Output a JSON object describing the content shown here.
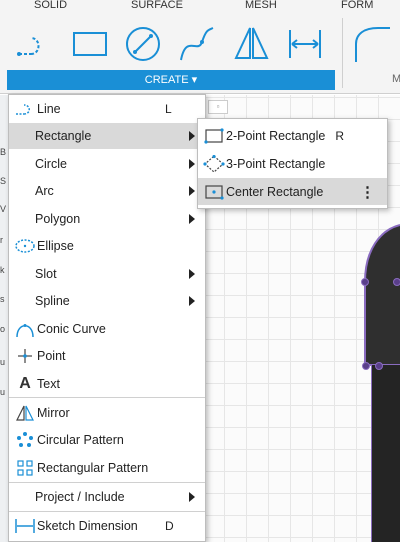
{
  "toolbar": {
    "tabs": [
      "SOLID",
      "SURFACE",
      "MESH",
      "FORM"
    ],
    "create_label": "CREATE ▾",
    "modify_label": "M",
    "tools": [
      "line-tool-icon",
      "rectangle-tool-icon",
      "circle-tool-icon",
      "spline-tool-icon",
      "mirror-tool-icon",
      "dimension-tool-icon",
      "fillet-tool-icon"
    ]
  },
  "left_strip": [
    "B",
    "S",
    "V",
    "r",
    "k",
    "s",
    "o",
    "u",
    "u"
  ],
  "menu": {
    "items": [
      {
        "label": "Line",
        "shortcut": "L",
        "icon": "line-icon",
        "submenu": false
      },
      {
        "label": "Rectangle",
        "shortcut": "",
        "icon": "",
        "submenu": true,
        "highlighted": true
      },
      {
        "label": "Circle",
        "shortcut": "",
        "icon": "",
        "submenu": true
      },
      {
        "label": "Arc",
        "shortcut": "",
        "icon": "",
        "submenu": true
      },
      {
        "label": "Polygon",
        "shortcut": "",
        "icon": "",
        "submenu": true
      },
      {
        "label": "Ellipse",
        "shortcut": "",
        "icon": "ellipse-icon",
        "submenu": false
      },
      {
        "label": "Slot",
        "shortcut": "",
        "icon": "",
        "submenu": true
      },
      {
        "label": "Spline",
        "shortcut": "",
        "icon": "",
        "submenu": true
      },
      {
        "label": "Conic Curve",
        "shortcut": "",
        "icon": "conic-curve-icon",
        "submenu": false
      },
      {
        "label": "Point",
        "shortcut": "",
        "icon": "point-icon",
        "submenu": false
      },
      {
        "label": "Text",
        "shortcut": "",
        "icon": "text-icon",
        "submenu": false
      },
      {
        "label": "Mirror",
        "shortcut": "",
        "icon": "mirror-icon",
        "submenu": false
      },
      {
        "label": "Circular Pattern",
        "shortcut": "",
        "icon": "circular-pattern-icon",
        "submenu": false
      },
      {
        "label": "Rectangular Pattern",
        "shortcut": "",
        "icon": "rectangular-pattern-icon",
        "submenu": false
      },
      {
        "label": "Project / Include",
        "shortcut": "",
        "icon": "",
        "submenu": true
      },
      {
        "label": "Sketch Dimension",
        "shortcut": "D",
        "icon": "sketch-dimension-icon",
        "submenu": false
      }
    ]
  },
  "submenu": {
    "items": [
      {
        "label": "2-Point Rectangle",
        "shortcut": "R",
        "icon": "two-point-rectangle-icon"
      },
      {
        "label": "3-Point Rectangle",
        "shortcut": "",
        "icon": "three-point-rectangle-icon"
      },
      {
        "label": "Center Rectangle",
        "shortcut": "",
        "icon": "center-rectangle-icon",
        "highlighted": true,
        "more": "⋮"
      }
    ]
  },
  "colors": {
    "accent": "#1a8fd6",
    "highlight": "#d9d9d9",
    "sketch_body": "#2f2f2f",
    "sketch_outline": "#8a6cc0"
  }
}
